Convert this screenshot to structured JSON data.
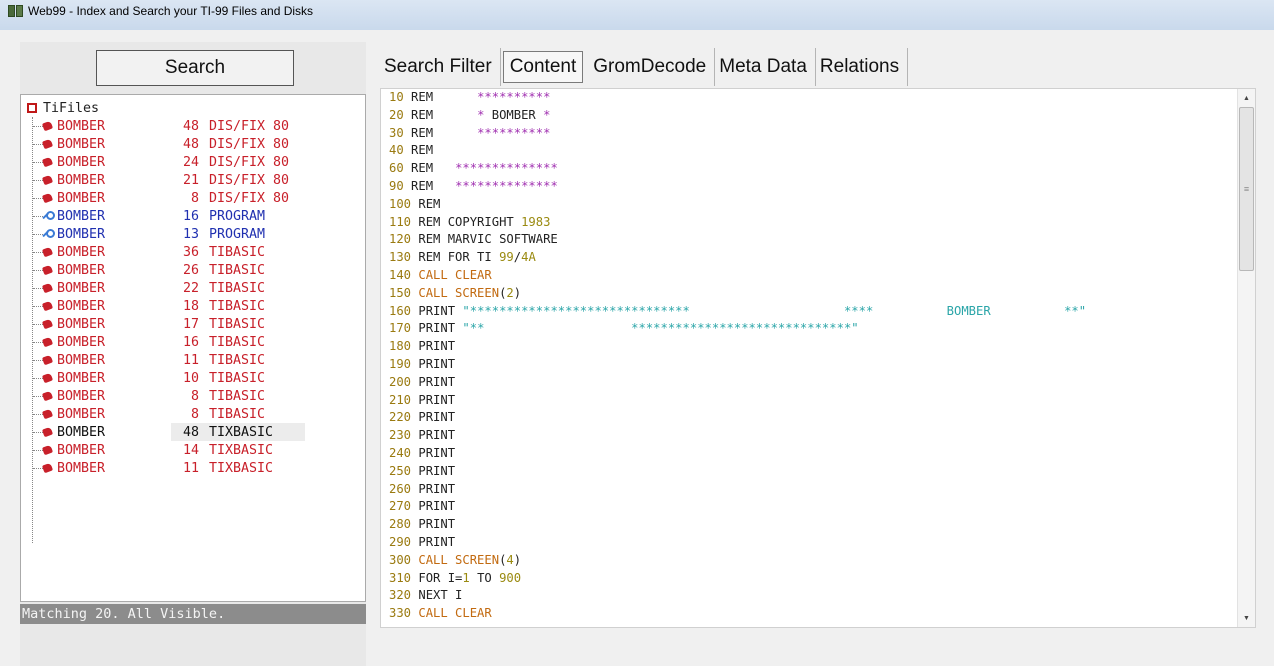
{
  "window": {
    "title": "Web99 - Index and Search your TI-99 Files and Disks"
  },
  "left": {
    "search_label": "Search",
    "root_label": "TiFiles",
    "files": [
      {
        "name": "BOMBER",
        "size": "48",
        "type": "DIS/FIX 80",
        "kind": "data"
      },
      {
        "name": "BOMBER",
        "size": "48",
        "type": "DIS/FIX 80",
        "kind": "data"
      },
      {
        "name": "BOMBER",
        "size": "24",
        "type": "DIS/FIX 80",
        "kind": "data"
      },
      {
        "name": "BOMBER",
        "size": "21",
        "type": "DIS/FIX 80",
        "kind": "data"
      },
      {
        "name": "BOMBER",
        "size": "8",
        "type": "DIS/FIX 80",
        "kind": "data"
      },
      {
        "name": "BOMBER",
        "size": "16",
        "type": "PROGRAM",
        "kind": "program"
      },
      {
        "name": "BOMBER",
        "size": "13",
        "type": "PROGRAM",
        "kind": "program"
      },
      {
        "name": "BOMBER",
        "size": "36",
        "type": "TIBASIC",
        "kind": "data"
      },
      {
        "name": "BOMBER",
        "size": "26",
        "type": "TIBASIC",
        "kind": "data"
      },
      {
        "name": "BOMBER",
        "size": "22",
        "type": "TIBASIC",
        "kind": "data"
      },
      {
        "name": "BOMBER",
        "size": "18",
        "type": "TIBASIC",
        "kind": "data"
      },
      {
        "name": "BOMBER",
        "size": "17",
        "type": "TIBASIC",
        "kind": "data"
      },
      {
        "name": "BOMBER",
        "size": "16",
        "type": "TIBASIC",
        "kind": "data"
      },
      {
        "name": "BOMBER",
        "size": "11",
        "type": "TIBASIC",
        "kind": "data"
      },
      {
        "name": "BOMBER",
        "size": "10",
        "type": "TIBASIC",
        "kind": "data"
      },
      {
        "name": "BOMBER",
        "size": "8",
        "type": "TIBASIC",
        "kind": "data"
      },
      {
        "name": "BOMBER",
        "size": "8",
        "type": "TIBASIC",
        "kind": "data"
      },
      {
        "name": "BOMBER",
        "size": "48",
        "type": "TIXBASIC",
        "kind": "selected"
      },
      {
        "name": "BOMBER",
        "size": "14",
        "type": "TIXBASIC",
        "kind": "data"
      },
      {
        "name": "BOMBER",
        "size": "11",
        "type": "TIXBASIC",
        "kind": "data"
      }
    ],
    "status": "Matching 20. All Visible."
  },
  "tabs": [
    {
      "label": "Search Filter",
      "active": false
    },
    {
      "label": "Content",
      "active": true
    },
    {
      "label": "GromDecode",
      "active": false
    },
    {
      "label": "Meta Data",
      "active": false
    },
    {
      "label": "Relations",
      "active": false
    }
  ],
  "code_lines": [
    [
      [
        "ln",
        "10"
      ],
      [
        "kw",
        " REM      "
      ],
      [
        "mag",
        "**********"
      ]
    ],
    [
      [
        "ln",
        "20"
      ],
      [
        "kw",
        " REM      "
      ],
      [
        "mag",
        "* "
      ],
      [
        "kw",
        "BOMBER "
      ],
      [
        "mag",
        "*"
      ]
    ],
    [
      [
        "ln",
        "30"
      ],
      [
        "kw",
        " REM      "
      ],
      [
        "mag",
        "**********"
      ]
    ],
    [
      [
        "ln",
        "40"
      ],
      [
        "kw",
        " REM"
      ]
    ],
    [
      [
        "ln",
        "60"
      ],
      [
        "kw",
        " REM   "
      ],
      [
        "mag",
        "**************"
      ]
    ],
    [
      [
        "ln",
        "90"
      ],
      [
        "kw",
        " REM   "
      ],
      [
        "mag",
        "**************"
      ]
    ],
    [
      [
        "ln",
        "100"
      ],
      [
        "kw",
        " REM"
      ]
    ],
    [
      [
        "ln",
        "110"
      ],
      [
        "kw",
        " REM COPYRIGHT "
      ],
      [
        "num",
        "1983"
      ]
    ],
    [
      [
        "ln",
        "120"
      ],
      [
        "kw",
        " REM MARVIC SOFTWARE"
      ]
    ],
    [
      [
        "ln",
        "130"
      ],
      [
        "kw",
        " REM FOR TI "
      ],
      [
        "num",
        "99"
      ],
      [
        "kw",
        "/"
      ],
      [
        "num",
        "4A"
      ]
    ],
    [
      [
        "ln",
        "140"
      ],
      [
        "call",
        " CALL CLEAR"
      ]
    ],
    [
      [
        "ln",
        "150"
      ],
      [
        "call",
        " CALL SCREEN"
      ],
      [
        "kw",
        "("
      ],
      [
        "num",
        "2"
      ],
      [
        "kw",
        ")"
      ]
    ],
    [
      [
        "ln",
        "160"
      ],
      [
        "kw",
        " PRINT "
      ],
      [
        "cy",
        "\"******************************                     ****          BOMBER          **\""
      ]
    ],
    [
      [
        "ln",
        "170"
      ],
      [
        "kw",
        " PRINT "
      ],
      [
        "cy",
        "\"**                    ******************************\""
      ]
    ],
    [
      [
        "ln",
        "180"
      ],
      [
        "kw",
        " PRINT"
      ]
    ],
    [
      [
        "ln",
        "190"
      ],
      [
        "kw",
        " PRINT"
      ]
    ],
    [
      [
        "ln",
        "200"
      ],
      [
        "kw",
        " PRINT"
      ]
    ],
    [
      [
        "ln",
        "210"
      ],
      [
        "kw",
        " PRINT"
      ]
    ],
    [
      [
        "ln",
        "220"
      ],
      [
        "kw",
        " PRINT"
      ]
    ],
    [
      [
        "ln",
        "230"
      ],
      [
        "kw",
        " PRINT"
      ]
    ],
    [
      [
        "ln",
        "240"
      ],
      [
        "kw",
        " PRINT"
      ]
    ],
    [
      [
        "ln",
        "250"
      ],
      [
        "kw",
        " PRINT"
      ]
    ],
    [
      [
        "ln",
        "260"
      ],
      [
        "kw",
        " PRINT"
      ]
    ],
    [
      [
        "ln",
        "270"
      ],
      [
        "kw",
        " PRINT"
      ]
    ],
    [
      [
        "ln",
        "280"
      ],
      [
        "kw",
        " PRINT"
      ]
    ],
    [
      [
        "ln",
        "290"
      ],
      [
        "kw",
        " PRINT"
      ]
    ],
    [
      [
        "ln",
        "300"
      ],
      [
        "call",
        " CALL SCREEN"
      ],
      [
        "kw",
        "("
      ],
      [
        "num",
        "4"
      ],
      [
        "kw",
        ")"
      ]
    ],
    [
      [
        "ln",
        "310"
      ],
      [
        "kw",
        " FOR I="
      ],
      [
        "num",
        "1"
      ],
      [
        "kw",
        " TO "
      ],
      [
        "num",
        "900"
      ]
    ],
    [
      [
        "ln",
        "320"
      ],
      [
        "kw",
        " NEXT I"
      ]
    ],
    [
      [
        "ln",
        "330"
      ],
      [
        "call",
        " CALL CLEAR"
      ]
    ]
  ],
  "scroll": {
    "up_icon": "triangle-up",
    "down_icon": "triangle-down",
    "thumb_grip": "≡"
  }
}
